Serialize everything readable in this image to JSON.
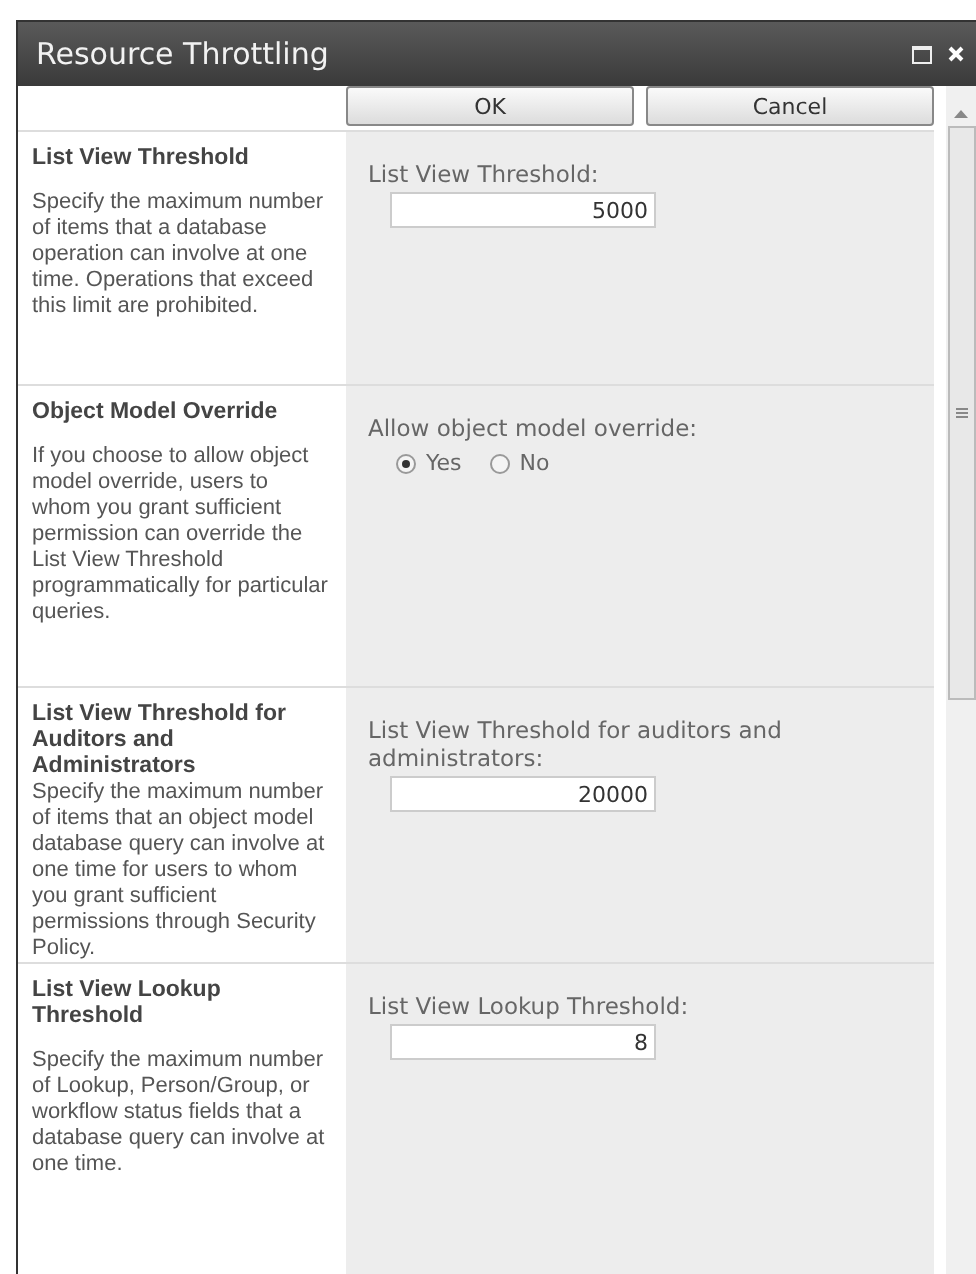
{
  "window": {
    "title": "Resource Throttling"
  },
  "buttons": [
    {
      "label": "OK"
    },
    {
      "label": "Cancel"
    }
  ],
  "sections": [
    {
      "kind": "text",
      "title": "List View Threshold",
      "description": "Specify the maximum number of items that a database operation can involve at one time. Operations that exceed this limit are prohibited.",
      "label": "List View Threshold:",
      "value": "5000"
    },
    {
      "kind": "radio",
      "title": "Object Model Override",
      "description": "If you choose to allow object model override, users to whom you grant sufficient permission can override the List View Threshold programmatically for particular queries.",
      "label": "Allow object model override:",
      "options": [
        {
          "label": "Yes",
          "selected": true
        },
        {
          "label": "No",
          "selected": false
        }
      ]
    },
    {
      "kind": "text",
      "title": "List View Threshold for Auditors and Administrators",
      "description": "Specify the maximum number of items that an object model database query can involve at one time for users to whom you grant sufficient permissions through Security Policy.",
      "label": "List View Threshold for auditors and administrators:",
      "value": "20000"
    },
    {
      "kind": "text",
      "title": "List View Lookup Threshold",
      "description": "Specify the maximum number of Lookup, Person/Group, or workflow status fields that a database query can involve at one time.",
      "label": "List View Lookup Threshold:",
      "value": "8"
    }
  ]
}
